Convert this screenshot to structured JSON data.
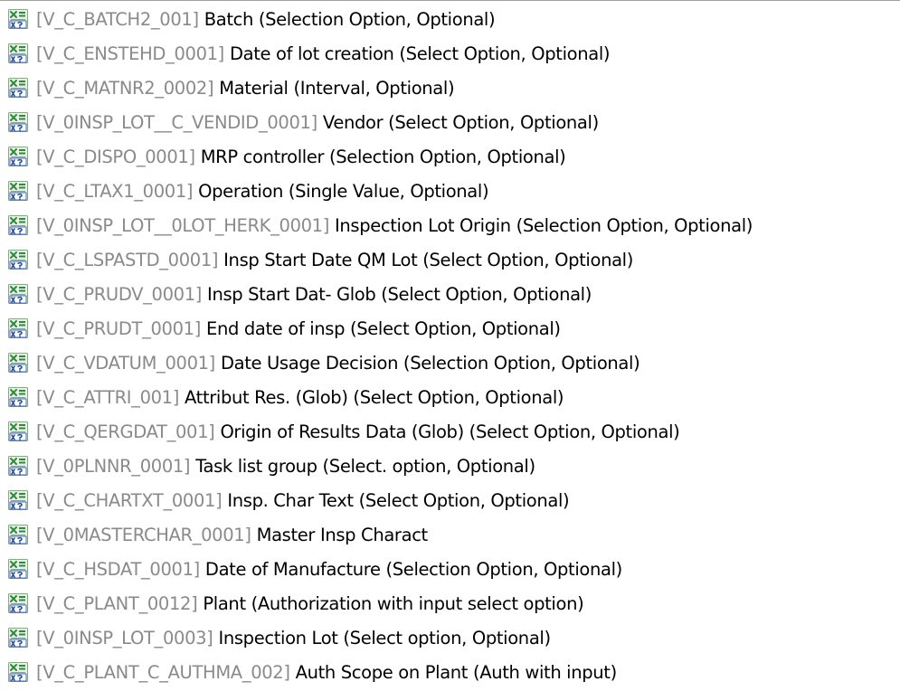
{
  "icon": "variable-icon",
  "colors": {
    "technical_name": "#8a8a8a",
    "description": "#000000",
    "icon_green": "#2e8b3c",
    "icon_blue": "#1b4fa8"
  },
  "items": [
    {
      "tech": "[V_C_BATCH2_001]",
      "desc": "Batch (Selection Option, Optional)"
    },
    {
      "tech": "[V_C_ENSTEHD_0001]",
      "desc": "Date of lot creation (Select Option, Optional)"
    },
    {
      "tech": "[V_C_MATNR2_0002]",
      "desc": "Material (Interval, Optional)"
    },
    {
      "tech": "[V_0INSP_LOT__C_VENDID_0001]",
      "desc": "Vendor (Select Option, Optional)"
    },
    {
      "tech": "[V_C_DISPO_0001]",
      "desc": "MRP controller (Selection Option, Optional)"
    },
    {
      "tech": "[V_C_LTAX1_0001]",
      "desc": "Operation (Single Value, Optional)"
    },
    {
      "tech": "[V_0INSP_LOT__0LOT_HERK_0001]",
      "desc": "Inspection Lot Origin (Selection Option, Optional)"
    },
    {
      "tech": "[V_C_LSPASTD_0001]",
      "desc": "Insp Start Date QM Lot (Select Option, Optional)"
    },
    {
      "tech": "[V_C_PRUDV_0001]",
      "desc": "Insp Start Dat- Glob (Select Option, Optional)"
    },
    {
      "tech": "[V_C_PRUDT_0001]",
      "desc": "End date of insp (Select Option, Optional)"
    },
    {
      "tech": "[V_C_VDATUM_0001]",
      "desc": "Date Usage Decision (Selection Option, Optional)"
    },
    {
      "tech": "[V_C_ATTRI_001]",
      "desc": "Attribut Res. (Glob) (Select Option, Optional)"
    },
    {
      "tech": "[V_C_QERGDAT_001]",
      "desc": "Origin of Results Data (Glob) (Select Option, Optional)"
    },
    {
      "tech": "[V_0PLNNR_0001]",
      "desc": "Task list group (Select. option, Optional)"
    },
    {
      "tech": "[V_C_CHARTXT_0001]",
      "desc": "Insp. Char Text (Select Option, Optional)"
    },
    {
      "tech": "[V_0MASTERCHAR_0001]",
      "desc": "Master Insp Charact"
    },
    {
      "tech": "[V_C_HSDAT_0001]",
      "desc": "Date of Manufacture (Selection Option, Optional)"
    },
    {
      "tech": "[V_C_PLANT_0012]",
      "desc": "Plant (Authorization with input select option)"
    },
    {
      "tech": "[V_0INSP_LOT_0003]",
      "desc": "Inspection Lot (Select option, Optional)"
    },
    {
      "tech": "[V_C_PLANT_C_AUTHMA_002]",
      "desc": "Auth Scope on Plant (Auth with input)"
    }
  ]
}
